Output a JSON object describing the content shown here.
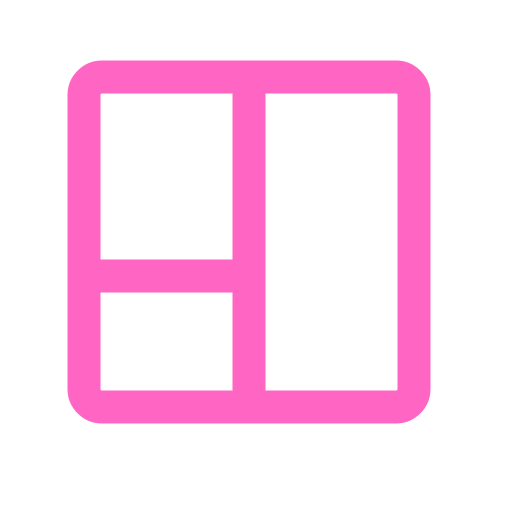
{
  "icon": {
    "name": "layout-dashboard-icon",
    "color": "#ff66c4",
    "background": "#ffffff"
  }
}
